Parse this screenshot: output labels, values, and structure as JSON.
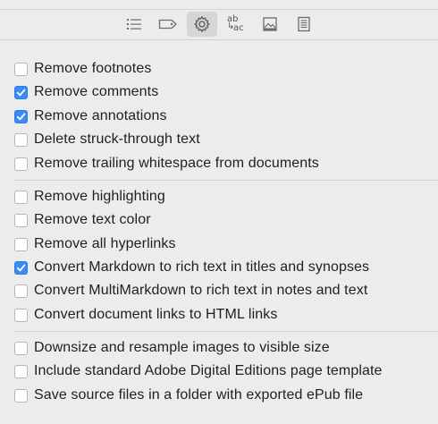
{
  "toolbar": {
    "buttons": [
      {
        "icon": "list-icon",
        "active": false
      },
      {
        "icon": "tag-icon",
        "active": false
      },
      {
        "icon": "gear-icon",
        "active": true
      },
      {
        "icon": "text-replace-icon",
        "active": false,
        "text_top": "ab",
        "text_bottom": "ac",
        "arrow": "↳"
      },
      {
        "icon": "image-icon",
        "active": false
      },
      {
        "icon": "document-icon",
        "active": false
      }
    ]
  },
  "groups": [
    {
      "options": [
        {
          "label": "Remove footnotes",
          "checked": false
        },
        {
          "label": "Remove comments",
          "checked": true
        },
        {
          "label": "Remove annotations",
          "checked": true
        },
        {
          "label": "Delete struck-through text",
          "checked": false
        },
        {
          "label": "Remove trailing whitespace from documents",
          "checked": false
        }
      ]
    },
    {
      "options": [
        {
          "label": "Remove highlighting",
          "checked": false
        },
        {
          "label": "Remove text color",
          "checked": false
        },
        {
          "label": "Remove all hyperlinks",
          "checked": false
        },
        {
          "label": "Convert Markdown to rich text in titles and synopses",
          "checked": true
        },
        {
          "label": "Convert MultiMarkdown to rich text in notes and text",
          "checked": false
        },
        {
          "label": "Convert document links to HTML links",
          "checked": false
        }
      ]
    },
    {
      "options": [
        {
          "label": "Downsize and resample images to visible size",
          "checked": false
        },
        {
          "label": "Include standard Adobe Digital Editions page template",
          "checked": false
        },
        {
          "label": "Save source files in a folder with exported ePub file",
          "checked": false
        }
      ]
    }
  ],
  "colors": {
    "background": "#ececec",
    "checkbox_checked": "#3b8bf5",
    "active_tab": "#d6d6d6"
  }
}
